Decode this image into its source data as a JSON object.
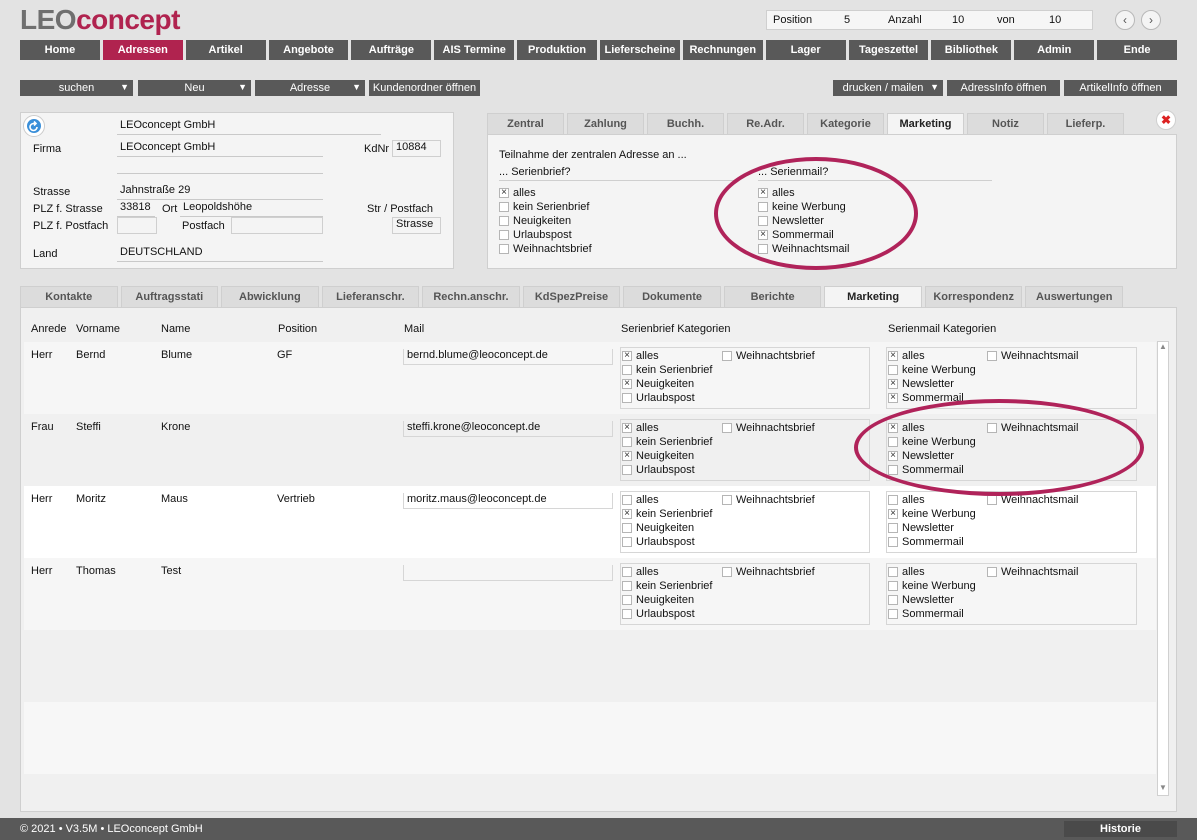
{
  "logo": {
    "part1": "LEO",
    "part2": "concept"
  },
  "position_bar": {
    "position_label": "Position",
    "position_value": "5",
    "count_label": "Anzahl",
    "count_value": "10",
    "of_label": "von",
    "of_value": "10"
  },
  "menu": [
    "Home",
    "Adressen",
    "Artikel",
    "Angebote",
    "Aufträge",
    "AIS Termine",
    "Produktion",
    "Lieferscheine",
    "Rechnungen",
    "Lager",
    "Tageszettel",
    "Bibliothek",
    "Admin",
    "Ende"
  ],
  "menu_active": 1,
  "toolbar": {
    "search": "suchen",
    "new": "Neu",
    "address": "Adresse",
    "customer_folder": "Kundenordner öffnen",
    "print": "drucken / mailen",
    "addr_info": "AdressInfo öffnen",
    "article_info": "ArtikelInfo öffnen"
  },
  "address": {
    "name_line": "LEOconcept GmbH",
    "firma_label": "Firma",
    "firma": "LEOconcept GmbH",
    "kdnr_label": "KdNr",
    "kdnr": "10884",
    "street_label": "Strasse",
    "street": "Jahnstraße 29",
    "plz_street_label": "PLZ f. Strasse",
    "plz": "33818",
    "ort_label": "Ort",
    "ort": "Leopoldshöhe",
    "str_postfach_label": "Str / Postfach",
    "plz_postfach_label": "PLZ f. Postfach",
    "postfach_label": "Postfach",
    "str_postfach_value": "Strasse",
    "country_label": "Land",
    "country": "DEUTSCHLAND"
  },
  "top_tabs": [
    "Zentral",
    "Zahlung",
    "Buchh.",
    "Re.Adr.",
    "Kategorie",
    "Marketing",
    "Notiz",
    "Lieferp."
  ],
  "top_tab_active": 5,
  "marketing": {
    "intro": "Teilnahme der zentralen Adresse an ...",
    "serienbrief_title": "... Serienbrief?",
    "serienmail_title": "... Serienmail?",
    "serienbrief": [
      {
        "label": "alles",
        "checked": true
      },
      {
        "label": "kein Serienbrief",
        "checked": false
      },
      {
        "label": "Neuigkeiten",
        "checked": false
      },
      {
        "label": "Urlaubspost",
        "checked": false
      },
      {
        "label": "Weihnachtsbrief",
        "checked": false
      }
    ],
    "serienmail": [
      {
        "label": "alles",
        "checked": true
      },
      {
        "label": "keine Werbung",
        "checked": false
      },
      {
        "label": "Newsletter",
        "checked": false
      },
      {
        "label": "Sommermail",
        "checked": true
      },
      {
        "label": "Weihnachtsmail",
        "checked": false
      }
    ]
  },
  "bottom_tabs": [
    "Kontakte",
    "Auftragsstati",
    "Abwicklung",
    "Lieferanschr.",
    "Rechn.anschr.",
    "KdSpezPreise",
    "Dokumente",
    "Berichte",
    "Marketing",
    "Korrespondenz",
    "Auswertungen"
  ],
  "bottom_tab_active": 8,
  "table": {
    "headers": {
      "anrede": "Anrede",
      "vorname": "Vorname",
      "name": "Name",
      "position": "Position",
      "mail": "Mail",
      "brief": "Serienbrief Kategorien",
      "email": "Serienmail Kategorien"
    },
    "brief_labels": [
      "alles",
      "kein Serienbrief",
      "Neuigkeiten",
      "Urlaubspost"
    ],
    "brief_extra": "Weihnachtsbrief",
    "mail_labels": [
      "alles",
      "keine Werbung",
      "Newsletter",
      "Sommermail"
    ],
    "mail_extra": "Weihnachtsmail",
    "rows": [
      {
        "anrede": "Herr",
        "vorname": "Bernd",
        "name": "Blume",
        "position": "GF",
        "mail": "bernd.blume@leoconcept.de",
        "brief": [
          true,
          false,
          true,
          false
        ],
        "brief_extra": false,
        "email": [
          true,
          false,
          true,
          true
        ],
        "email_extra": false
      },
      {
        "anrede": "Frau",
        "vorname": "Steffi",
        "name": "Krone",
        "position": "",
        "mail": "steffi.krone@leoconcept.de",
        "brief": [
          true,
          false,
          true,
          false
        ],
        "brief_extra": false,
        "email": [
          true,
          false,
          true,
          false
        ],
        "email_extra": false
      },
      {
        "anrede": "Herr",
        "vorname": "Moritz",
        "name": "Maus",
        "position": "Vertrieb",
        "mail": "moritz.maus@leoconcept.de",
        "brief": [
          false,
          true,
          false,
          false
        ],
        "brief_extra": false,
        "email": [
          false,
          true,
          false,
          false
        ],
        "email_extra": false
      },
      {
        "anrede": "Herr",
        "vorname": "Thomas",
        "name": "Test",
        "position": "",
        "mail": "",
        "brief": [
          false,
          false,
          false,
          false
        ],
        "brief_extra": false,
        "email": [
          false,
          false,
          false,
          false
        ],
        "email_extra": false
      }
    ]
  },
  "footer": {
    "copyright": "© 2021 • V3.5M • LEOconcept GmbH",
    "history": "Historie"
  },
  "icons": {
    "back": "back-arrow-icon",
    "close": "close-icon",
    "prev": "chevron-left-icon",
    "next": "chevron-right-icon"
  },
  "colors": {
    "accent": "#b0234f",
    "menu": "#595959"
  }
}
